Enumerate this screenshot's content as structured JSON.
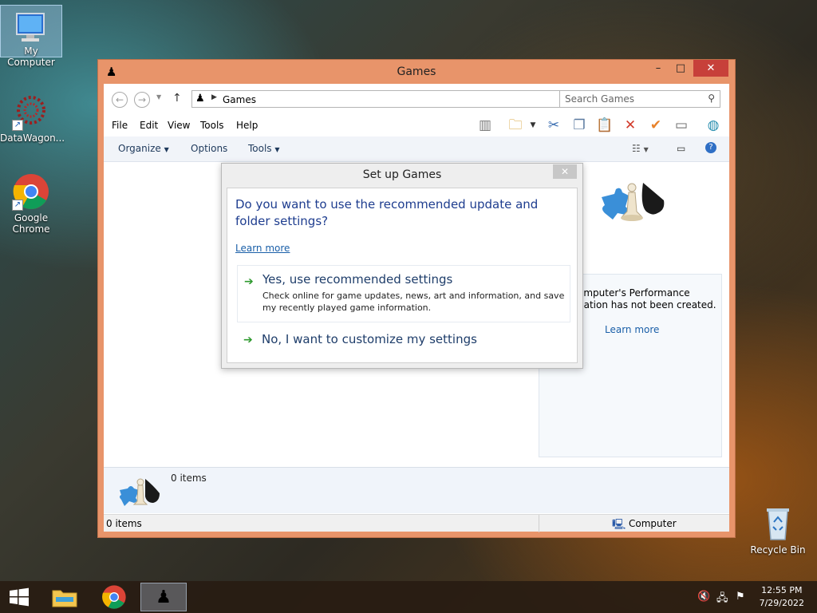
{
  "desktop": {
    "icons": [
      {
        "label": "My Computer",
        "icon": "computer-icon"
      },
      {
        "label": "DataWagon...",
        "icon": "datawagon-icon"
      },
      {
        "label": "Google Chrome",
        "icon": "chrome-icon"
      },
      {
        "label": "Recycle Bin",
        "icon": "recycle-bin-icon"
      }
    ]
  },
  "window": {
    "title": "Games",
    "controls": {
      "minimize": "–",
      "maximize": "□",
      "close": "✕"
    },
    "address": {
      "crumb": "Games"
    },
    "search": {
      "placeholder": "Search Games"
    },
    "menu": [
      "File",
      "Edit",
      "View",
      "Tools",
      "Help"
    ],
    "commands": {
      "organize": "Organize",
      "options": "Options",
      "tools": "Tools"
    },
    "performance": {
      "line1": "omputer's Performance",
      "line2": "nation has not been created.",
      "link": "Learn more"
    },
    "details": {
      "count": "0 items"
    },
    "status": {
      "items": "0 items",
      "location": "Computer"
    }
  },
  "dialog": {
    "title": "Set up Games",
    "close": "✕",
    "question": "Do you want to use the recommended update and folder settings?",
    "learn_more": "Learn more",
    "option_yes": {
      "title": "Yes, use recommended settings",
      "description": "Check online for game updates, news, art and information, and save my recently played game information."
    },
    "option_no": {
      "title": "No, I want to customize my settings"
    }
  },
  "taskbar": {
    "clock": {
      "time": "12:55 PM",
      "date": "7/29/2022"
    }
  },
  "colors": {
    "title_bar": "#e8946a",
    "close_button": "#c7403a",
    "link": "#1a5fa8",
    "heading": "#1e3d8f"
  }
}
